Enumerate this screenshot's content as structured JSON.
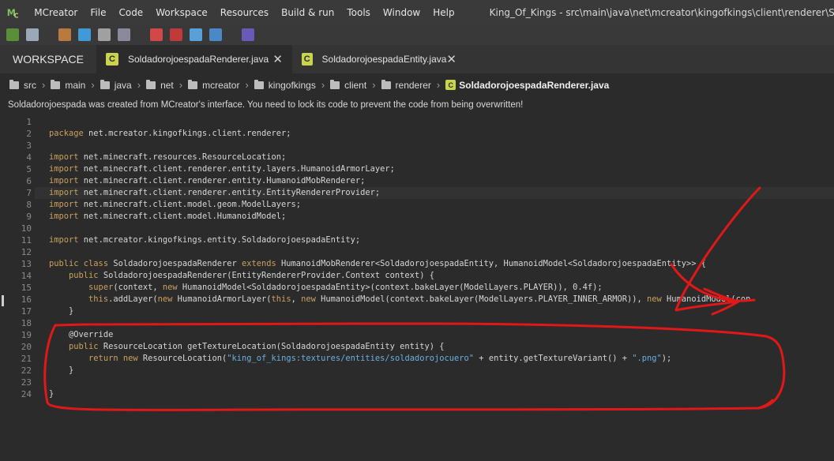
{
  "menubar": {
    "items": [
      "MCreator",
      "File",
      "Code",
      "Workspace",
      "Resources",
      "Build & run",
      "Tools",
      "Window",
      "Help"
    ],
    "window_title": "King_Of_Kings - src\\main\\java\\net\\mcreator\\kingofkings\\client\\renderer\\Soldadorojoespada"
  },
  "tabs": {
    "workspace": "WORKSPACE",
    "files": [
      {
        "label": "SoldadorojoespadaRenderer.java",
        "badge": "C"
      },
      {
        "label": "SoldadorojoespadaEntity.java",
        "badge": "C"
      }
    ]
  },
  "breadcrumb": [
    "src",
    "main",
    "java",
    "net",
    "mcreator",
    "kingofkings",
    "client",
    "renderer"
  ],
  "breadcrumb_file": "SoldadorojoespadaRenderer.java",
  "notice": "Soldadorojoespada was created from MCreator's interface. You need to lock its code to prevent the code from being overwritten!",
  "code": {
    "line_numbers": [
      "1",
      "2",
      "3",
      "4",
      "5",
      "6",
      "7",
      "8",
      "9",
      "10",
      "11",
      "12",
      "13",
      "14",
      "15",
      "16",
      "17",
      "18",
      "19",
      "20",
      "21",
      "22",
      "23",
      "24"
    ],
    "l2": [
      "package",
      " net.mcreator.kingofkings.client.renderer;"
    ],
    "l4": [
      "import",
      " net.minecraft.resources.ResourceLocation;"
    ],
    "l5": [
      "import",
      " net.minecraft.client.renderer.entity.layers.HumanoidArmorLayer;"
    ],
    "l6": [
      "import",
      " net.minecraft.client.renderer.entity.HumanoidMobRenderer;"
    ],
    "l7": [
      "import",
      " net.minecraft.client.renderer.entity.EntityRendererProvider;"
    ],
    "l8": [
      "import",
      " net.minecraft.client.model.geom.ModelLayers;"
    ],
    "l9": [
      "import",
      " net.minecraft.client.model.HumanoidModel;"
    ],
    "l11": [
      "import",
      " net.mcreator.kingofkings.entity.SoldadorojoespadaEntity;"
    ],
    "l13": [
      "public class",
      " SoldadorojoespadaRenderer ",
      "extends",
      " HumanoidMobRenderer<SoldadorojoespadaEntity, HumanoidModel<SoldadorojoespadaEntity>> {"
    ],
    "l14": [
      "    ",
      "public",
      " SoldadorojoespadaRenderer(EntityRendererProvider.Context context) {"
    ],
    "l15": [
      "        ",
      "super",
      "(context, ",
      "new",
      " HumanoidModel<SoldadorojoespadaEntity>(context.bakeLayer(ModelLayers.PLAYER)), 0.4f);"
    ],
    "l16": [
      "        ",
      "this",
      ".addLayer(",
      "new",
      " HumanoidArmorLayer(",
      "this",
      ", ",
      "new",
      " HumanoidModel(context.bakeLayer(ModelLayers.PLAYER_INNER_ARMOR)), ",
      "new",
      " HumanoidModel(con"
    ],
    "l17": [
      "    }"
    ],
    "l19": [
      "    @Override"
    ],
    "l20": [
      "    ",
      "public",
      " ResourceLocation getTextureLocation(SoldadorojoespadaEntity entity) {"
    ],
    "l21": [
      "        ",
      "return",
      " ",
      "new",
      " ResourceLocation(",
      "\"king_of_kings:textures/entities/soldadorojocuero\"",
      " + entity.getTextureVariant() + ",
      "\".png\"",
      ");"
    ],
    "l22": [
      "    }"
    ],
    "l24": [
      "}"
    ]
  },
  "colors": {
    "keyword": "#c9a15e",
    "string": "#6ab0de",
    "annotation_ink": "#e01818",
    "badge": "#c9d44e"
  }
}
